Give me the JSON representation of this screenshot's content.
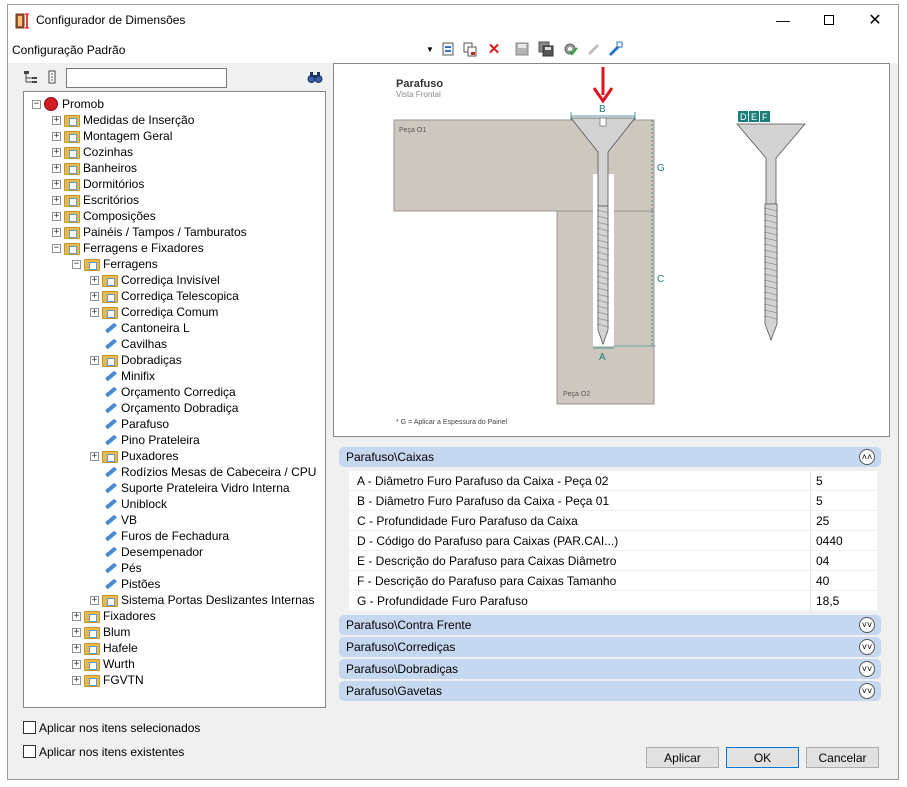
{
  "window": {
    "title": "Configurador de Dimensões"
  },
  "toolbar": {
    "config_label": "Configuração Padrão"
  },
  "search": {
    "value": ""
  },
  "tree": [
    {
      "label": "Promob",
      "level": 0,
      "icon": "root",
      "exp": "-"
    },
    {
      "label": "Medidas de Inserção",
      "level": 1,
      "icon": "folder",
      "exp": "+"
    },
    {
      "label": "Montagem Geral",
      "level": 1,
      "icon": "folder",
      "exp": "+"
    },
    {
      "label": "Cozinhas",
      "level": 1,
      "icon": "folder",
      "exp": "+"
    },
    {
      "label": "Banheiros",
      "level": 1,
      "icon": "folder",
      "exp": "+"
    },
    {
      "label": "Dormitórios",
      "level": 1,
      "icon": "folder",
      "exp": "+"
    },
    {
      "label": "Escritórios",
      "level": 1,
      "icon": "folder",
      "exp": "+"
    },
    {
      "label": "Composições",
      "level": 1,
      "icon": "folder",
      "exp": "+"
    },
    {
      "label": "Painéis / Tampos / Tamburatos",
      "level": 1,
      "icon": "folder",
      "exp": "+"
    },
    {
      "label": "Ferragens e Fixadores",
      "level": 1,
      "icon": "folder",
      "exp": "-"
    },
    {
      "label": "Ferragens",
      "level": 2,
      "icon": "folder",
      "exp": "-"
    },
    {
      "label": "Corrediça Invisível",
      "level": 3,
      "icon": "folder",
      "exp": "+"
    },
    {
      "label": "Corrediça Telescopica",
      "level": 3,
      "icon": "folder",
      "exp": "+"
    },
    {
      "label": "Corrediça Comum",
      "level": 3,
      "icon": "folder",
      "exp": "+"
    },
    {
      "label": "Cantoneira L",
      "level": 3,
      "icon": "item",
      "exp": ""
    },
    {
      "label": "Cavilhas",
      "level": 3,
      "icon": "item",
      "exp": ""
    },
    {
      "label": "Dobradiças",
      "level": 3,
      "icon": "folder",
      "exp": "+"
    },
    {
      "label": "Minifix",
      "level": 3,
      "icon": "item",
      "exp": ""
    },
    {
      "label": "Orçamento Corrediça",
      "level": 3,
      "icon": "item",
      "exp": ""
    },
    {
      "label": "Orçamento Dobradiça",
      "level": 3,
      "icon": "item",
      "exp": ""
    },
    {
      "label": "Parafuso",
      "level": 3,
      "icon": "item",
      "exp": ""
    },
    {
      "label": "Pino Prateleira",
      "level": 3,
      "icon": "item",
      "exp": ""
    },
    {
      "label": "Puxadores",
      "level": 3,
      "icon": "folder",
      "exp": "+"
    },
    {
      "label": "Rodízios Mesas de Cabeceira / CPU",
      "level": 3,
      "icon": "item",
      "exp": ""
    },
    {
      "label": "Suporte Prateleira Vidro Interna",
      "level": 3,
      "icon": "item",
      "exp": ""
    },
    {
      "label": "Uniblock",
      "level": 3,
      "icon": "item",
      "exp": ""
    },
    {
      "label": "VB",
      "level": 3,
      "icon": "item",
      "exp": ""
    },
    {
      "label": "Furos de Fechadura",
      "level": 3,
      "icon": "item",
      "exp": ""
    },
    {
      "label": "Desempenador",
      "level": 3,
      "icon": "item",
      "exp": ""
    },
    {
      "label": "Pés",
      "level": 3,
      "icon": "item",
      "exp": ""
    },
    {
      "label": "Pistões",
      "level": 3,
      "icon": "item",
      "exp": ""
    },
    {
      "label": "Sistema Portas Deslizantes Internas",
      "level": 3,
      "icon": "folder",
      "exp": "+"
    },
    {
      "label": "Fixadores",
      "level": 2,
      "icon": "folder",
      "exp": "+"
    },
    {
      "label": "Blum",
      "level": 2,
      "icon": "folder",
      "exp": "+"
    },
    {
      "label": "Hafele",
      "level": 2,
      "icon": "folder",
      "exp": "+"
    },
    {
      "label": "Wurth",
      "level": 2,
      "icon": "folder",
      "exp": "+"
    },
    {
      "label": "FGVTN",
      "level": 2,
      "icon": "folder",
      "exp": "+"
    }
  ],
  "preview": {
    "title": "Parafuso",
    "subtitle": "Vista Frontal",
    "piece1": "Peça O1",
    "piece2": "Peça O2",
    "dim_a": "A",
    "dim_b": "B",
    "dim_c": "C",
    "dim_g": "G",
    "dim_d": "D",
    "dim_e": "E",
    "dim_f": "F",
    "footnote": "* G = Aplicar a Espessura do Painel"
  },
  "panels": {
    "caixas": {
      "title": "Parafuso\\Caixas",
      "rows": [
        {
          "label": "A - Diâmetro Furo Parafuso da Caixa - Peça 02",
          "value": "5"
        },
        {
          "label": "B - Diâmetro Furo Parafuso da Caixa - Peça 01",
          "value": "5"
        },
        {
          "label": "C - Profundidade Furo Parafuso da Caixa",
          "value": "25"
        },
        {
          "label": "D - Código do Parafuso para Caixas (PAR.CAI...)",
          "value": "0440"
        },
        {
          "label": "E - Descrição do Parafuso para Caixas Diâmetro",
          "value": "04"
        },
        {
          "label": "F - Descrição do Parafuso para Caixas Tamanho",
          "value": "40"
        },
        {
          "label": "G - Profundidade Furo Parafuso",
          "value": "18,5"
        }
      ]
    },
    "contra_frente": "Parafuso\\Contra Frente",
    "correditas": "Parafuso\\Corrediças",
    "dobradicas": "Parafuso\\Dobradiças",
    "gavetas": "Parafuso\\Gavetas"
  },
  "options": {
    "apply_selected": "Aplicar nos itens selecionados",
    "apply_existing": "Aplicar nos itens existentes"
  },
  "buttons": {
    "apply": "Aplicar",
    "ok": "OK",
    "cancel": "Cancelar"
  },
  "colors": {
    "accent": "#1a7f7a",
    "panel_header": "#c6d8ef",
    "arrow": "#e0141e"
  }
}
